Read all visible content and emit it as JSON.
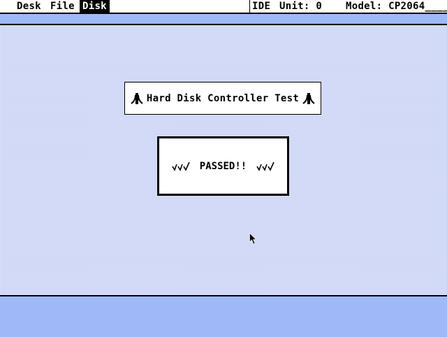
{
  "menubar": {
    "items": [
      {
        "label": "Desk",
        "selected": false
      },
      {
        "label": "File",
        "selected": false
      },
      {
        "label": "Disk",
        "selected": true
      }
    ],
    "interface": "IDE",
    "unit": "Unit: 0",
    "model": "Model: CP2064_____"
  },
  "title_dialog": {
    "title": "Hard Disk Controller Test",
    "icons": [
      "atari-logo-icon",
      "atari-logo-icon"
    ]
  },
  "result_dialog": {
    "status": "PASSED!!",
    "icons": [
      "checkmarks-icon",
      "checkmarks-icon"
    ]
  },
  "colors": {
    "desktop": "#aab8f0",
    "strip": "#9fb8f8",
    "ink": "#000000",
    "paper": "#ffffff"
  }
}
